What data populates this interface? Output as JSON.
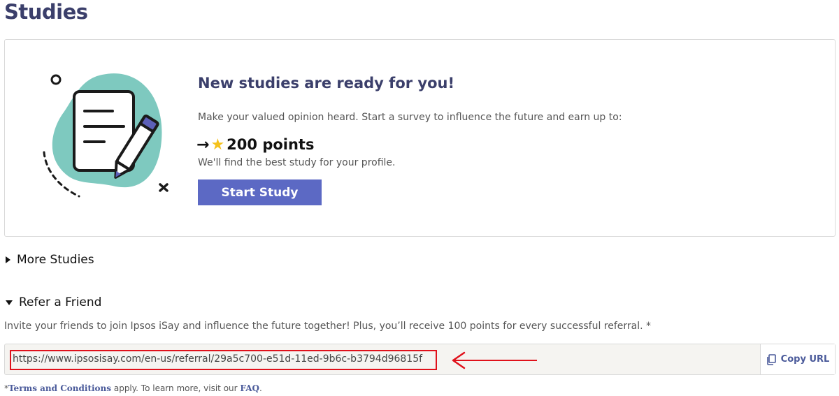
{
  "page": {
    "title": "Studies"
  },
  "card": {
    "heading": "New studies are ready for you!",
    "description": "Make your valued opinion heard. Start a survey to influence the future and earn up to:",
    "points_label": "200 points",
    "arrow_icon": "right-arrow-icon",
    "star_icon": "star-icon",
    "subtext": "We'll find the best study for your profile.",
    "start_button": "Start Study",
    "illustration_icon": "survey-document-pencil-icon",
    "accent_color": "#5c69c4",
    "blob_color": "#7ec9bf"
  },
  "more_studies": {
    "label": "More Studies",
    "expanded": false
  },
  "refer": {
    "label": "Refer a Friend",
    "expanded": true,
    "description": "Invite your friends to join Ipsos iSay and influence the future together! Plus, you’ll receive 100 points for every successful referral. *",
    "url": "https://www.ipsosisay.com/en-us/referral/29a5c700-e51d-11ed-9b6c-b3794d96815f",
    "copy_button": "Copy URL",
    "highlight_color": "#e0111b"
  },
  "footnote": {
    "prefix": "*",
    "terms_link": "Terms and Conditions",
    "middle": " apply. To learn more, visit our ",
    "faq_link": "FAQ",
    "suffix": "."
  }
}
